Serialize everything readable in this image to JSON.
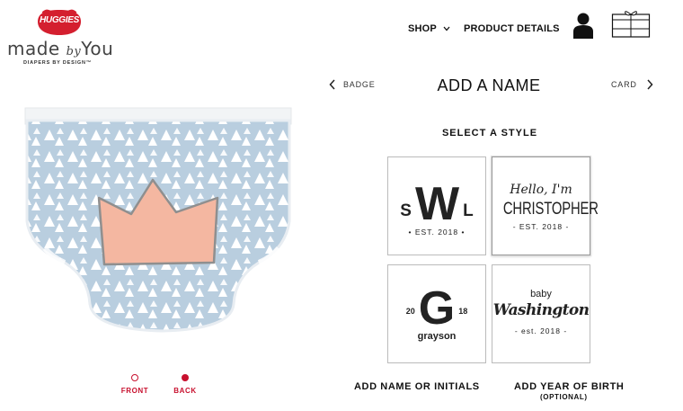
{
  "brand": {
    "badge_text": "HUGGIES",
    "script_made": "made",
    "script_by": "by",
    "script_you": "You",
    "tagline": "DIAPERS BY DESIGN™"
  },
  "nav": {
    "shop_label": "SHOP",
    "product_details_label": "PRODUCT DETAILS",
    "icons": [
      "chevron-down-icon",
      "user-icon",
      "gift-box-icon"
    ]
  },
  "steps": {
    "prev_label": "BADGE",
    "title": "ADD A NAME",
    "next_label": "CARD"
  },
  "style_section": {
    "heading": "SELECT A STYLE",
    "selected_index": 1,
    "tiles": [
      {
        "left": "S",
        "center": "W",
        "right": "L",
        "sub": "• EST. 2018 •"
      },
      {
        "line1": "Hello, I'm",
        "line2": "CHRISTOPHER",
        "sub": "- EST. 2018 -"
      },
      {
        "left": "20",
        "center": "G",
        "right": "18",
        "sub": "grayson"
      },
      {
        "line1": "baby",
        "line2": "Washington",
        "sub": "- est. 2018 -"
      }
    ]
  },
  "fields": {
    "name_label": "ADD NAME OR INITIALS",
    "year_label": "ADD YEAR OF BIRTH",
    "year_note": "(OPTIONAL)"
  },
  "preview": {
    "views": [
      {
        "label": "FRONT",
        "active": false
      },
      {
        "label": "BACK",
        "active": true
      }
    ]
  },
  "colors": {
    "brand_red": "#c8102e",
    "diaper_blue": "#b9cedf",
    "badge_peach": "#f4b7a1"
  }
}
